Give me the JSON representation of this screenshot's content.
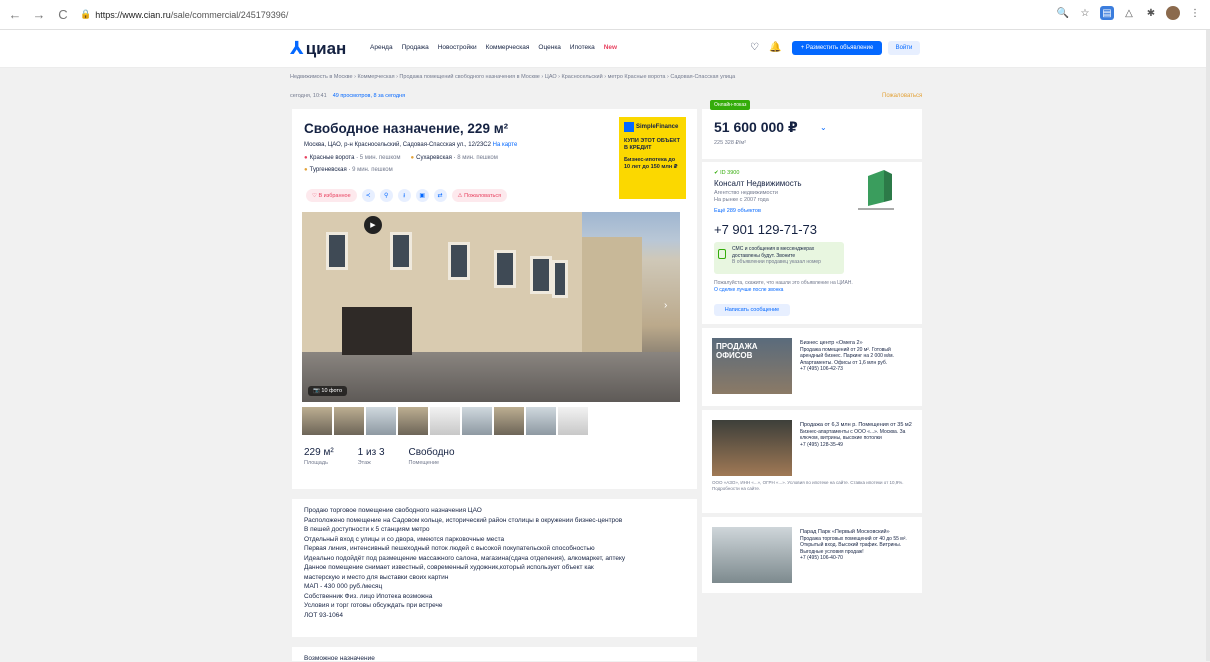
{
  "browser": {
    "url_host": "https://www.cian.ru",
    "url_path": "/sale/commercial/245179396/",
    "back": "←",
    "forward": "→",
    "reload": "C"
  },
  "header": {
    "logo": "циан",
    "nav": [
      "Аренда",
      "Продажа",
      "Новостройки",
      "Коммерческая",
      "Оценка",
      "Ипотека"
    ],
    "nav_new": "New",
    "place_ad": "+ Разместить объявление",
    "login": "Войти"
  },
  "breadcrumbs": "Недвижимость в Москве  ›  Коммерческая  ›  Продажа помещений свободного назначения в Москве  ›  ЦАО  ›  Красносельский  ›  метро Красные ворота  ›  Садовая-Спасская улица",
  "meta": {
    "updated": "сегодня, 10:41",
    "views": "49 просмотров, 8 за сегодня",
    "complain": "Пожаловаться"
  },
  "listing": {
    "title": "Свободное назначение, 229 м²",
    "address": "Москва, ЦАО, р-н Красносельский, Садовая-Спасская ул., 12/23С2",
    "map_link": "На карте",
    "metro": [
      {
        "name": "Красные ворота",
        "time": "5 мин. пешком"
      },
      {
        "name": "Сухаревская",
        "time": "8 мин. пешком"
      },
      {
        "name": "Тургеневская",
        "time": "9 мин. пешком"
      }
    ],
    "favorite": "В избранное",
    "complain_pill": "Пожаловаться",
    "photo_count": "10 фото",
    "facts": [
      {
        "value": "229 м²",
        "label": "Площадь"
      },
      {
        "value": "1 из 3",
        "label": "Этаж"
      },
      {
        "value": "Свободно",
        "label": "Помещение"
      }
    ],
    "description": [
      "Продаю торговое помещение свободного назначения ЦАО",
      "Расположено помещение на Садовом кольце, исторический район столицы в окружении бизнес-центров",
      "В пешей доступности к 5 станциям метро",
      "Отдельный вход с улицы и со двора, имеются парковочные места",
      "Первая линия, интенсивный пешеходный поток людей с высокой покупательской способностью",
      "Идеально подойдёт под размещение массажного салона, магазина(сдача отделения), алкомаркет, аптеку",
      "Данное помещение снимает известный, современный художник,который использует объект как",
      "мастерскую и место для выставки своих картин",
      "МАП - 430 000 руб./месяц",
      "Собственник Физ. лицо Ипотека возможна",
      "Условия и торг готовы обсуждать при встрече",
      "ЛОТ 93-1064"
    ],
    "purpose_heading": "Возможное назначение"
  },
  "promo": {
    "brand": "SimpleFinance",
    "line1": "КУПИ ЭТОТ ОБЪЕКТ В КРЕДИТ",
    "line2": "Бизнес-ипотека до 10 лет до 150 млн ₽"
  },
  "price_card": {
    "badge": "Онлайн-показ",
    "price": "51 600 000 ₽",
    "per_meter": "225 328 ₽/м²"
  },
  "agent": {
    "id": "ID 3900",
    "name": "Консалт Недвижимость",
    "subtitle": "Агентство недвижимости",
    "since": "На рынке с 2007 года",
    "objects_link": "Ещё 289 объектов",
    "phone": "+7 901 129-71-73",
    "sms_title": "СМС и сообщения в мессенджерах доставлены будут. Звоните",
    "sms_sub": "В объявлении продавец указал номер",
    "note": "Пожалуйста, скажите, что нашли это объявление на ЦИАН.",
    "note_link": "О сделке лучше после звонка",
    "write_button": "Написать сообщение"
  },
  "side_ads": [
    {
      "img_text": "ПРОДАЖА ОФИСОВ",
      "title": "Бизнес центр «Омега 2»",
      "text": "Продажа помещений от 20 м². Готовый арендный бизнес. Паркинг на 2 000 м/м. Апартаменты. Офисы от 1,6 млн руб.",
      "phone": "+7 (495) 106-42-73",
      "footer": ""
    },
    {
      "img_text": "",
      "title": "Продажа от 6,3 млн р. Помещения от 35 м2",
      "text": "Бизнес-апартаменты с ООО «...». Москва. За ключом, витрины, высокие потолки",
      "phone": "+7 (495) 128-35-49",
      "footer": "ООО «АЗО», ИНН «...», ОГРН «...». Условия по ипотеке на сайте. Ставка ипотеки от 10,9%. Подробности на сайте."
    },
    {
      "img_text": "",
      "title": "Парад Парк «Первый Московский»",
      "text": "Продажа торговых помещений от 40 до 55 м². Открытый вход. Высокий трафик. Витрины. Выгодные условия продаж!",
      "phone": "+7 (495) 106-40-70",
      "footer": ""
    }
  ]
}
